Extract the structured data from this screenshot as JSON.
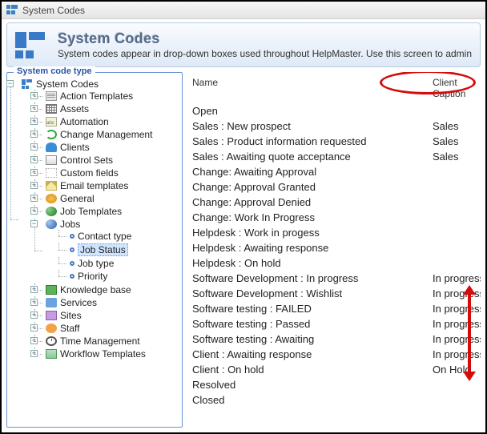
{
  "window": {
    "title": "System Codes"
  },
  "banner": {
    "heading": "System Codes",
    "sub": "System codes appear in drop-down boxes used throughout HelpMaster.  Use this screen to admin"
  },
  "tree": {
    "legend": "System code type",
    "root": "System Codes",
    "root_expander": "−",
    "nodes": [
      {
        "label": "Action Templates",
        "icon": "ic-doc",
        "exp": "+"
      },
      {
        "label": "Assets",
        "icon": "ic-grid",
        "exp": "+"
      },
      {
        "label": "Automation",
        "icon": "ic-abc",
        "exp": "+"
      },
      {
        "label": "Change Management",
        "icon": "ic-cycle",
        "exp": "+"
      },
      {
        "label": "Clients",
        "icon": "ic-person",
        "exp": "+"
      },
      {
        "label": "Control Sets",
        "icon": "ic-panel",
        "exp": "+"
      },
      {
        "label": "Custom fields",
        "icon": "ic-blank",
        "exp": "+"
      },
      {
        "label": "Email templates",
        "icon": "ic-mail",
        "exp": "+"
      },
      {
        "label": "General",
        "icon": "ic-gen",
        "exp": "+"
      },
      {
        "label": "Job Templates",
        "icon": "ic-sphere",
        "exp": "+"
      },
      {
        "label": "Jobs",
        "icon": "ic-sphere-b",
        "exp": "−",
        "children": [
          {
            "label": "Contact type",
            "icon": "ic-disc"
          },
          {
            "label": "Job Status",
            "icon": "ic-disc",
            "selected": true
          },
          {
            "label": "Job type",
            "icon": "ic-disc"
          },
          {
            "label": "Priority",
            "icon": "ic-disc"
          }
        ]
      },
      {
        "label": "Knowledge base",
        "icon": "ic-book",
        "exp": "+"
      },
      {
        "label": "Services",
        "icon": "ic-ppl",
        "exp": "+"
      },
      {
        "label": "Sites",
        "icon": "ic-site",
        "exp": "+"
      },
      {
        "label": "Staff",
        "icon": "ic-staff",
        "exp": "+"
      },
      {
        "label": "Time Management",
        "icon": "ic-clock",
        "exp": "+"
      },
      {
        "label": "Workflow Templates",
        "icon": "ic-flow",
        "exp": "+"
      }
    ]
  },
  "table": {
    "cols": {
      "name": "Name",
      "caption": "Client Caption"
    },
    "rows": [
      {
        "name": "Open",
        "cap": ""
      },
      {
        "name": "Sales : New prospect",
        "cap": "Sales"
      },
      {
        "name": "Sales : Product information requested",
        "cap": "Sales"
      },
      {
        "name": "Sales : Awaiting quote acceptance",
        "cap": "Sales"
      },
      {
        "name": "Change:  Awaiting Approval",
        "cap": ""
      },
      {
        "name": "Change: Approval Granted",
        "cap": ""
      },
      {
        "name": "Change: Approval Denied",
        "cap": ""
      },
      {
        "name": "Change: Work In Progress",
        "cap": ""
      },
      {
        "name": "Helpdesk : Work in progess",
        "cap": ""
      },
      {
        "name": "Helpdesk : Awaiting response",
        "cap": ""
      },
      {
        "name": "Helpdesk : On hold",
        "cap": ""
      },
      {
        "name": "Software Development : In progress",
        "cap": "In progress"
      },
      {
        "name": "Software Development : Wishlist",
        "cap": "In progress"
      },
      {
        "name": "Software testing : FAILED",
        "cap": "In progress"
      },
      {
        "name": "Software testing : Passed",
        "cap": "In progress"
      },
      {
        "name": "Software testing : Awaiting",
        "cap": "In progress"
      },
      {
        "name": "Client : Awaiting response",
        "cap": "In progress"
      },
      {
        "name": "Client : On hold",
        "cap": "On Hold"
      },
      {
        "name": "Resolved",
        "cap": ""
      },
      {
        "name": "Closed",
        "cap": ""
      }
    ]
  }
}
